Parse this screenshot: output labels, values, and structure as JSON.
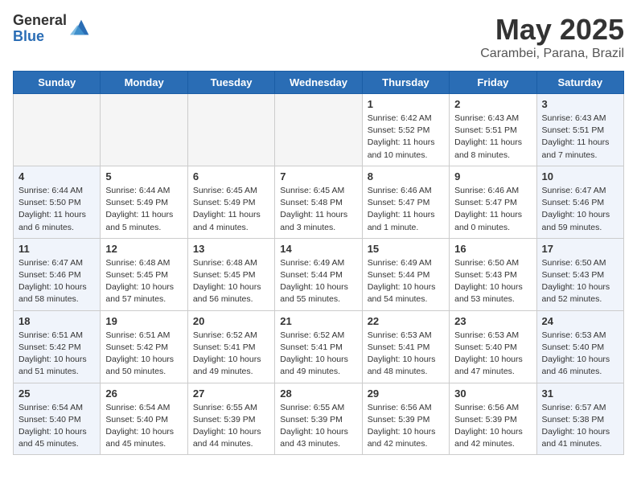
{
  "header": {
    "logo_general": "General",
    "logo_blue": "Blue",
    "month_title": "May 2025",
    "location": "Carambei, Parana, Brazil"
  },
  "weekdays": [
    "Sunday",
    "Monday",
    "Tuesday",
    "Wednesday",
    "Thursday",
    "Friday",
    "Saturday"
  ],
  "weeks": [
    [
      {
        "num": "",
        "empty": true
      },
      {
        "num": "",
        "empty": true
      },
      {
        "num": "",
        "empty": true
      },
      {
        "num": "",
        "empty": true
      },
      {
        "num": "1",
        "info": "Sunrise: 6:42 AM\nSunset: 5:52 PM\nDaylight: 11 hours and 10 minutes."
      },
      {
        "num": "2",
        "info": "Sunrise: 6:43 AM\nSunset: 5:51 PM\nDaylight: 11 hours and 8 minutes."
      },
      {
        "num": "3",
        "info": "Sunrise: 6:43 AM\nSunset: 5:51 PM\nDaylight: 11 hours and 7 minutes."
      }
    ],
    [
      {
        "num": "4",
        "info": "Sunrise: 6:44 AM\nSunset: 5:50 PM\nDaylight: 11 hours and 6 minutes."
      },
      {
        "num": "5",
        "info": "Sunrise: 6:44 AM\nSunset: 5:49 PM\nDaylight: 11 hours and 5 minutes."
      },
      {
        "num": "6",
        "info": "Sunrise: 6:45 AM\nSunset: 5:49 PM\nDaylight: 11 hours and 4 minutes."
      },
      {
        "num": "7",
        "info": "Sunrise: 6:45 AM\nSunset: 5:48 PM\nDaylight: 11 hours and 3 minutes."
      },
      {
        "num": "8",
        "info": "Sunrise: 6:46 AM\nSunset: 5:47 PM\nDaylight: 11 hours and 1 minute."
      },
      {
        "num": "9",
        "info": "Sunrise: 6:46 AM\nSunset: 5:47 PM\nDaylight: 11 hours and 0 minutes."
      },
      {
        "num": "10",
        "info": "Sunrise: 6:47 AM\nSunset: 5:46 PM\nDaylight: 10 hours and 59 minutes."
      }
    ],
    [
      {
        "num": "11",
        "info": "Sunrise: 6:47 AM\nSunset: 5:46 PM\nDaylight: 10 hours and 58 minutes."
      },
      {
        "num": "12",
        "info": "Sunrise: 6:48 AM\nSunset: 5:45 PM\nDaylight: 10 hours and 57 minutes."
      },
      {
        "num": "13",
        "info": "Sunrise: 6:48 AM\nSunset: 5:45 PM\nDaylight: 10 hours and 56 minutes."
      },
      {
        "num": "14",
        "info": "Sunrise: 6:49 AM\nSunset: 5:44 PM\nDaylight: 10 hours and 55 minutes."
      },
      {
        "num": "15",
        "info": "Sunrise: 6:49 AM\nSunset: 5:44 PM\nDaylight: 10 hours and 54 minutes."
      },
      {
        "num": "16",
        "info": "Sunrise: 6:50 AM\nSunset: 5:43 PM\nDaylight: 10 hours and 53 minutes."
      },
      {
        "num": "17",
        "info": "Sunrise: 6:50 AM\nSunset: 5:43 PM\nDaylight: 10 hours and 52 minutes."
      }
    ],
    [
      {
        "num": "18",
        "info": "Sunrise: 6:51 AM\nSunset: 5:42 PM\nDaylight: 10 hours and 51 minutes."
      },
      {
        "num": "19",
        "info": "Sunrise: 6:51 AM\nSunset: 5:42 PM\nDaylight: 10 hours and 50 minutes."
      },
      {
        "num": "20",
        "info": "Sunrise: 6:52 AM\nSunset: 5:41 PM\nDaylight: 10 hours and 49 minutes."
      },
      {
        "num": "21",
        "info": "Sunrise: 6:52 AM\nSunset: 5:41 PM\nDaylight: 10 hours and 49 minutes."
      },
      {
        "num": "22",
        "info": "Sunrise: 6:53 AM\nSunset: 5:41 PM\nDaylight: 10 hours and 48 minutes."
      },
      {
        "num": "23",
        "info": "Sunrise: 6:53 AM\nSunset: 5:40 PM\nDaylight: 10 hours and 47 minutes."
      },
      {
        "num": "24",
        "info": "Sunrise: 6:53 AM\nSunset: 5:40 PM\nDaylight: 10 hours and 46 minutes."
      }
    ],
    [
      {
        "num": "25",
        "info": "Sunrise: 6:54 AM\nSunset: 5:40 PM\nDaylight: 10 hours and 45 minutes."
      },
      {
        "num": "26",
        "info": "Sunrise: 6:54 AM\nSunset: 5:40 PM\nDaylight: 10 hours and 45 minutes."
      },
      {
        "num": "27",
        "info": "Sunrise: 6:55 AM\nSunset: 5:39 PM\nDaylight: 10 hours and 44 minutes."
      },
      {
        "num": "28",
        "info": "Sunrise: 6:55 AM\nSunset: 5:39 PM\nDaylight: 10 hours and 43 minutes."
      },
      {
        "num": "29",
        "info": "Sunrise: 6:56 AM\nSunset: 5:39 PM\nDaylight: 10 hours and 42 minutes."
      },
      {
        "num": "30",
        "info": "Sunrise: 6:56 AM\nSunset: 5:39 PM\nDaylight: 10 hours and 42 minutes."
      },
      {
        "num": "31",
        "info": "Sunrise: 6:57 AM\nSunset: 5:38 PM\nDaylight: 10 hours and 41 minutes."
      }
    ]
  ]
}
